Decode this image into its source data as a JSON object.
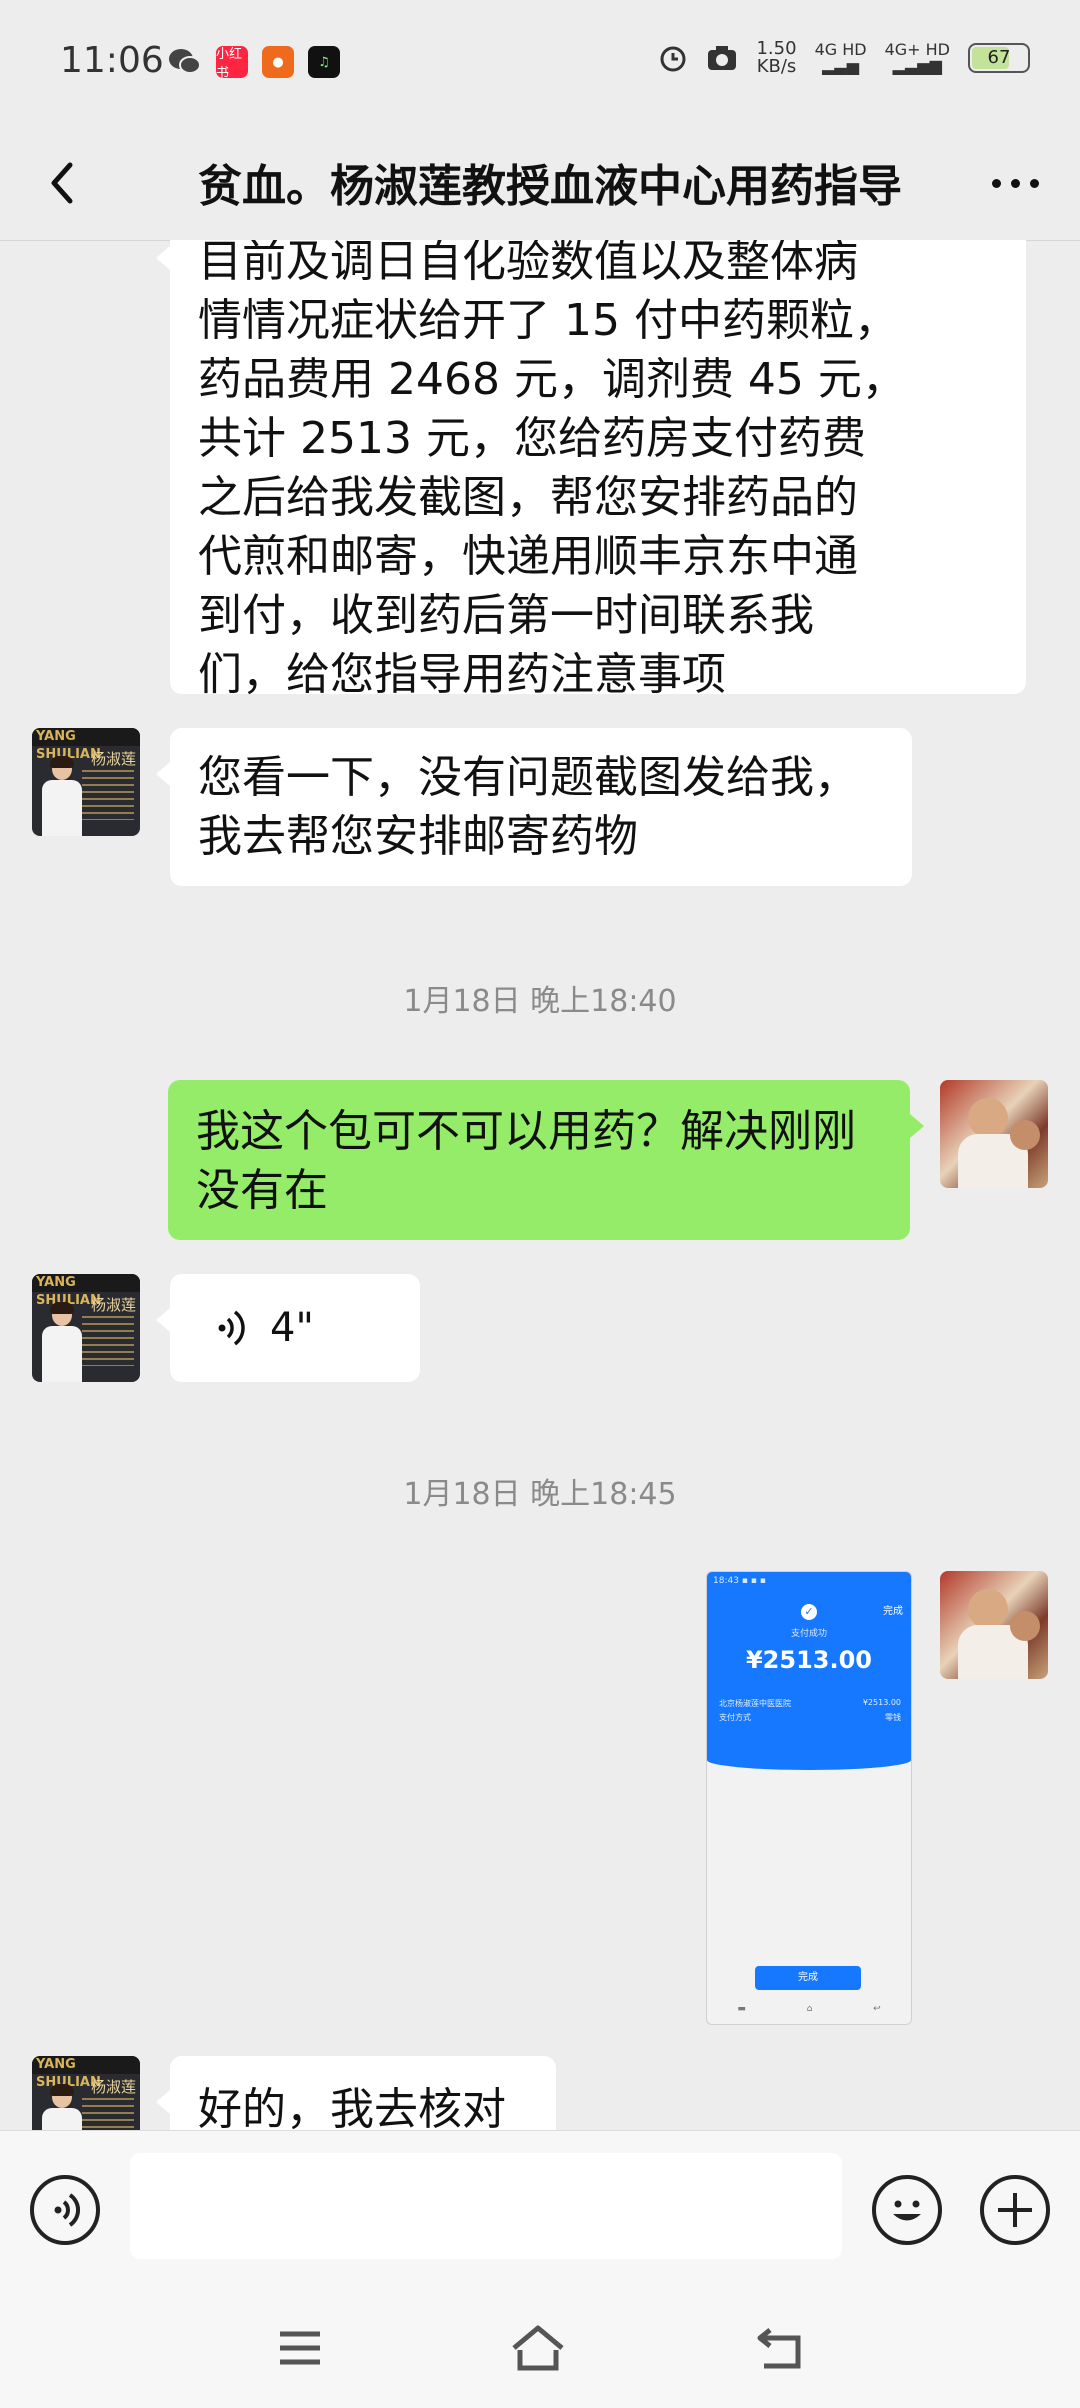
{
  "status_bar": {
    "time": "11:06",
    "apps": [
      {
        "icon": "wechat-icon",
        "label": ""
      },
      {
        "icon": "xiaohongshu-icon",
        "label": "小红书"
      },
      {
        "icon": "pizza-app-icon",
        "label": ""
      },
      {
        "icon": "music-app-icon",
        "label": ""
      }
    ],
    "speed_value": "1.50",
    "speed_unit": "KB/s",
    "network_1": "4G HD",
    "network_2": "4G+ HD",
    "battery": "67"
  },
  "nav": {
    "title": "贫血。杨淑莲教授血液中心用药指导"
  },
  "doctor_avatar": {
    "band_text": "YANG SHULIAN",
    "name_text": "杨淑莲"
  },
  "messages": [
    {
      "side": "in",
      "lines": [
        "目前及调日自化验数值以及整体病",
        "情情况症状给开了 15 付中药颗粒，",
        "药品费用 2468 元，调剂费 45 元，",
        "共计 2513 元，您给药房支付药费",
        "之后给我发截图，帮您安排药品的",
        "代煎和邮寄，快递用顺丰京东中通",
        "到付，收到药后第一时间联系我",
        "们，给您指导用药注意事项"
      ]
    },
    {
      "side": "in",
      "lines": [
        "您看一下，没有问题截图发给我，",
        "我去帮您安排邮寄药物"
      ]
    },
    {
      "side": "out",
      "lines": [
        "我这个包可不可以用药？解决刚刚",
        "没有在"
      ]
    },
    {
      "side": "in",
      "type": "voice",
      "duration": "4\""
    },
    {
      "side": "out",
      "type": "image",
      "screenshot": {
        "done": "完成",
        "status": "支付成功",
        "amount": "¥2513.00",
        "merchant": "北京杨淑莲中医医院",
        "merchant_amount": "¥2513.00",
        "pay_method": "支付方式",
        "pay_method_value": "零钱",
        "button": "完成"
      }
    },
    {
      "side": "in",
      "lines": [
        "好的，我去核对"
      ]
    }
  ],
  "timestamps": [
    "1月18日 晚上18:40",
    "1月18日 晚上18:45"
  ],
  "input": {
    "placeholder": ""
  },
  "colors": {
    "background": "#ededed",
    "outgoing_bubble": "#95ec69",
    "incoming_bubble": "#ffffff",
    "payment_blue": "#1677ff"
  }
}
